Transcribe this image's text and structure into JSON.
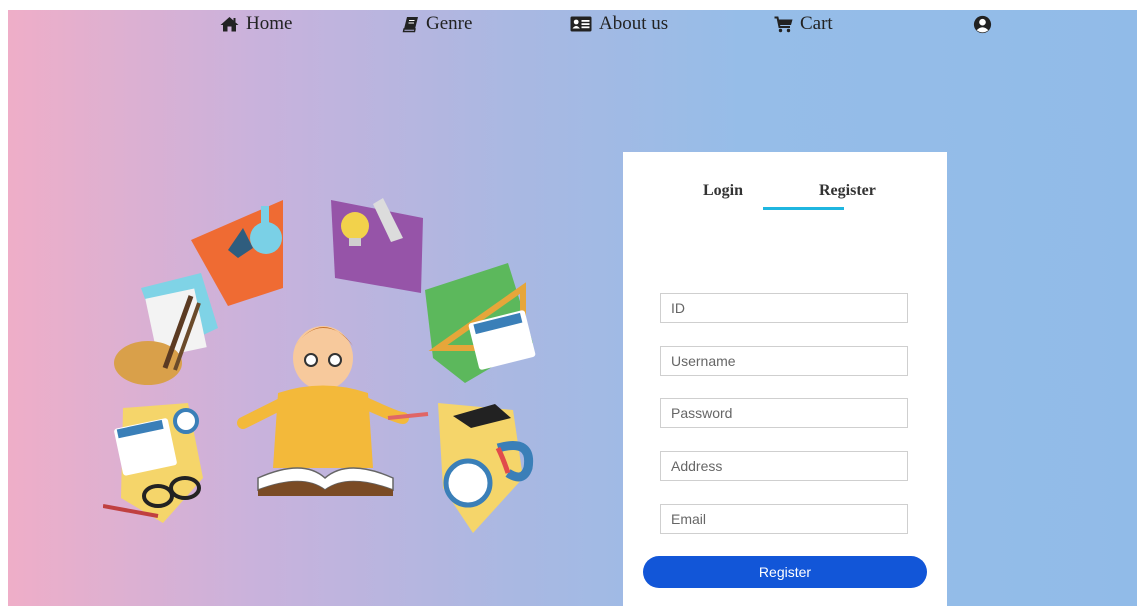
{
  "nav": {
    "items": [
      {
        "label": "Home",
        "icon": "home-icon"
      },
      {
        "label": "Genre",
        "icon": "book-icon"
      },
      {
        "label": "About us",
        "icon": "id-card-icon"
      },
      {
        "label": "Cart",
        "icon": "cart-icon"
      }
    ],
    "account_icon": "user-circle-icon"
  },
  "auth": {
    "tabs": [
      {
        "label": "Login",
        "active": false
      },
      {
        "label": "Register",
        "active": true
      }
    ],
    "accent": "#1fb6e0",
    "fields": [
      {
        "name": "id",
        "placeholder": "ID",
        "value": ""
      },
      {
        "name": "username",
        "placeholder": "Username",
        "value": ""
      },
      {
        "name": "password",
        "placeholder": "Password",
        "value": ""
      },
      {
        "name": "address",
        "placeholder": "Address",
        "value": ""
      },
      {
        "name": "email",
        "placeholder": "Email",
        "value": ""
      }
    ],
    "submit_label": "Register",
    "submit_color": "#1256d8"
  }
}
